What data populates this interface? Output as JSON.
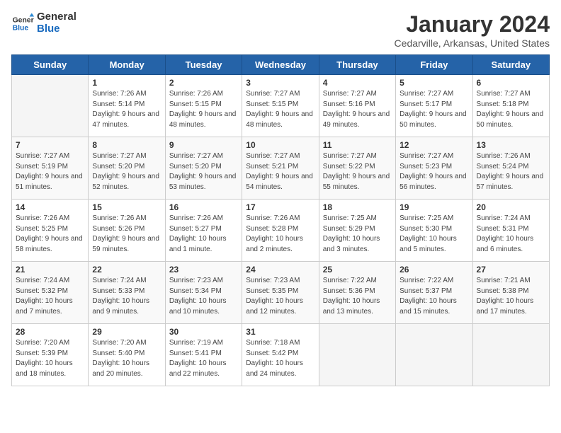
{
  "logo": {
    "line1": "General",
    "line2": "Blue"
  },
  "title": "January 2024",
  "location": "Cedarville, Arkansas, United States",
  "days_of_week": [
    "Sunday",
    "Monday",
    "Tuesday",
    "Wednesday",
    "Thursday",
    "Friday",
    "Saturday"
  ],
  "weeks": [
    [
      {
        "day": "",
        "sunrise": "",
        "sunset": "",
        "daylight": ""
      },
      {
        "day": "1",
        "sunrise": "Sunrise: 7:26 AM",
        "sunset": "Sunset: 5:14 PM",
        "daylight": "Daylight: 9 hours and 47 minutes."
      },
      {
        "day": "2",
        "sunrise": "Sunrise: 7:26 AM",
        "sunset": "Sunset: 5:15 PM",
        "daylight": "Daylight: 9 hours and 48 minutes."
      },
      {
        "day": "3",
        "sunrise": "Sunrise: 7:27 AM",
        "sunset": "Sunset: 5:15 PM",
        "daylight": "Daylight: 9 hours and 48 minutes."
      },
      {
        "day": "4",
        "sunrise": "Sunrise: 7:27 AM",
        "sunset": "Sunset: 5:16 PM",
        "daylight": "Daylight: 9 hours and 49 minutes."
      },
      {
        "day": "5",
        "sunrise": "Sunrise: 7:27 AM",
        "sunset": "Sunset: 5:17 PM",
        "daylight": "Daylight: 9 hours and 50 minutes."
      },
      {
        "day": "6",
        "sunrise": "Sunrise: 7:27 AM",
        "sunset": "Sunset: 5:18 PM",
        "daylight": "Daylight: 9 hours and 50 minutes."
      }
    ],
    [
      {
        "day": "7",
        "sunrise": "Sunrise: 7:27 AM",
        "sunset": "Sunset: 5:19 PM",
        "daylight": "Daylight: 9 hours and 51 minutes."
      },
      {
        "day": "8",
        "sunrise": "Sunrise: 7:27 AM",
        "sunset": "Sunset: 5:20 PM",
        "daylight": "Daylight: 9 hours and 52 minutes."
      },
      {
        "day": "9",
        "sunrise": "Sunrise: 7:27 AM",
        "sunset": "Sunset: 5:20 PM",
        "daylight": "Daylight: 9 hours and 53 minutes."
      },
      {
        "day": "10",
        "sunrise": "Sunrise: 7:27 AM",
        "sunset": "Sunset: 5:21 PM",
        "daylight": "Daylight: 9 hours and 54 minutes."
      },
      {
        "day": "11",
        "sunrise": "Sunrise: 7:27 AM",
        "sunset": "Sunset: 5:22 PM",
        "daylight": "Daylight: 9 hours and 55 minutes."
      },
      {
        "day": "12",
        "sunrise": "Sunrise: 7:27 AM",
        "sunset": "Sunset: 5:23 PM",
        "daylight": "Daylight: 9 hours and 56 minutes."
      },
      {
        "day": "13",
        "sunrise": "Sunrise: 7:26 AM",
        "sunset": "Sunset: 5:24 PM",
        "daylight": "Daylight: 9 hours and 57 minutes."
      }
    ],
    [
      {
        "day": "14",
        "sunrise": "Sunrise: 7:26 AM",
        "sunset": "Sunset: 5:25 PM",
        "daylight": "Daylight: 9 hours and 58 minutes."
      },
      {
        "day": "15",
        "sunrise": "Sunrise: 7:26 AM",
        "sunset": "Sunset: 5:26 PM",
        "daylight": "Daylight: 9 hours and 59 minutes."
      },
      {
        "day": "16",
        "sunrise": "Sunrise: 7:26 AM",
        "sunset": "Sunset: 5:27 PM",
        "daylight": "Daylight: 10 hours and 1 minute."
      },
      {
        "day": "17",
        "sunrise": "Sunrise: 7:26 AM",
        "sunset": "Sunset: 5:28 PM",
        "daylight": "Daylight: 10 hours and 2 minutes."
      },
      {
        "day": "18",
        "sunrise": "Sunrise: 7:25 AM",
        "sunset": "Sunset: 5:29 PM",
        "daylight": "Daylight: 10 hours and 3 minutes."
      },
      {
        "day": "19",
        "sunrise": "Sunrise: 7:25 AM",
        "sunset": "Sunset: 5:30 PM",
        "daylight": "Daylight: 10 hours and 5 minutes."
      },
      {
        "day": "20",
        "sunrise": "Sunrise: 7:24 AM",
        "sunset": "Sunset: 5:31 PM",
        "daylight": "Daylight: 10 hours and 6 minutes."
      }
    ],
    [
      {
        "day": "21",
        "sunrise": "Sunrise: 7:24 AM",
        "sunset": "Sunset: 5:32 PM",
        "daylight": "Daylight: 10 hours and 7 minutes."
      },
      {
        "day": "22",
        "sunrise": "Sunrise: 7:24 AM",
        "sunset": "Sunset: 5:33 PM",
        "daylight": "Daylight: 10 hours and 9 minutes."
      },
      {
        "day": "23",
        "sunrise": "Sunrise: 7:23 AM",
        "sunset": "Sunset: 5:34 PM",
        "daylight": "Daylight: 10 hours and 10 minutes."
      },
      {
        "day": "24",
        "sunrise": "Sunrise: 7:23 AM",
        "sunset": "Sunset: 5:35 PM",
        "daylight": "Daylight: 10 hours and 12 minutes."
      },
      {
        "day": "25",
        "sunrise": "Sunrise: 7:22 AM",
        "sunset": "Sunset: 5:36 PM",
        "daylight": "Daylight: 10 hours and 13 minutes."
      },
      {
        "day": "26",
        "sunrise": "Sunrise: 7:22 AM",
        "sunset": "Sunset: 5:37 PM",
        "daylight": "Daylight: 10 hours and 15 minutes."
      },
      {
        "day": "27",
        "sunrise": "Sunrise: 7:21 AM",
        "sunset": "Sunset: 5:38 PM",
        "daylight": "Daylight: 10 hours and 17 minutes."
      }
    ],
    [
      {
        "day": "28",
        "sunrise": "Sunrise: 7:20 AM",
        "sunset": "Sunset: 5:39 PM",
        "daylight": "Daylight: 10 hours and 18 minutes."
      },
      {
        "day": "29",
        "sunrise": "Sunrise: 7:20 AM",
        "sunset": "Sunset: 5:40 PM",
        "daylight": "Daylight: 10 hours and 20 minutes."
      },
      {
        "day": "30",
        "sunrise": "Sunrise: 7:19 AM",
        "sunset": "Sunset: 5:41 PM",
        "daylight": "Daylight: 10 hours and 22 minutes."
      },
      {
        "day": "31",
        "sunrise": "Sunrise: 7:18 AM",
        "sunset": "Sunset: 5:42 PM",
        "daylight": "Daylight: 10 hours and 24 minutes."
      },
      {
        "day": "",
        "sunrise": "",
        "sunset": "",
        "daylight": ""
      },
      {
        "day": "",
        "sunrise": "",
        "sunset": "",
        "daylight": ""
      },
      {
        "day": "",
        "sunrise": "",
        "sunset": "",
        "daylight": ""
      }
    ]
  ]
}
